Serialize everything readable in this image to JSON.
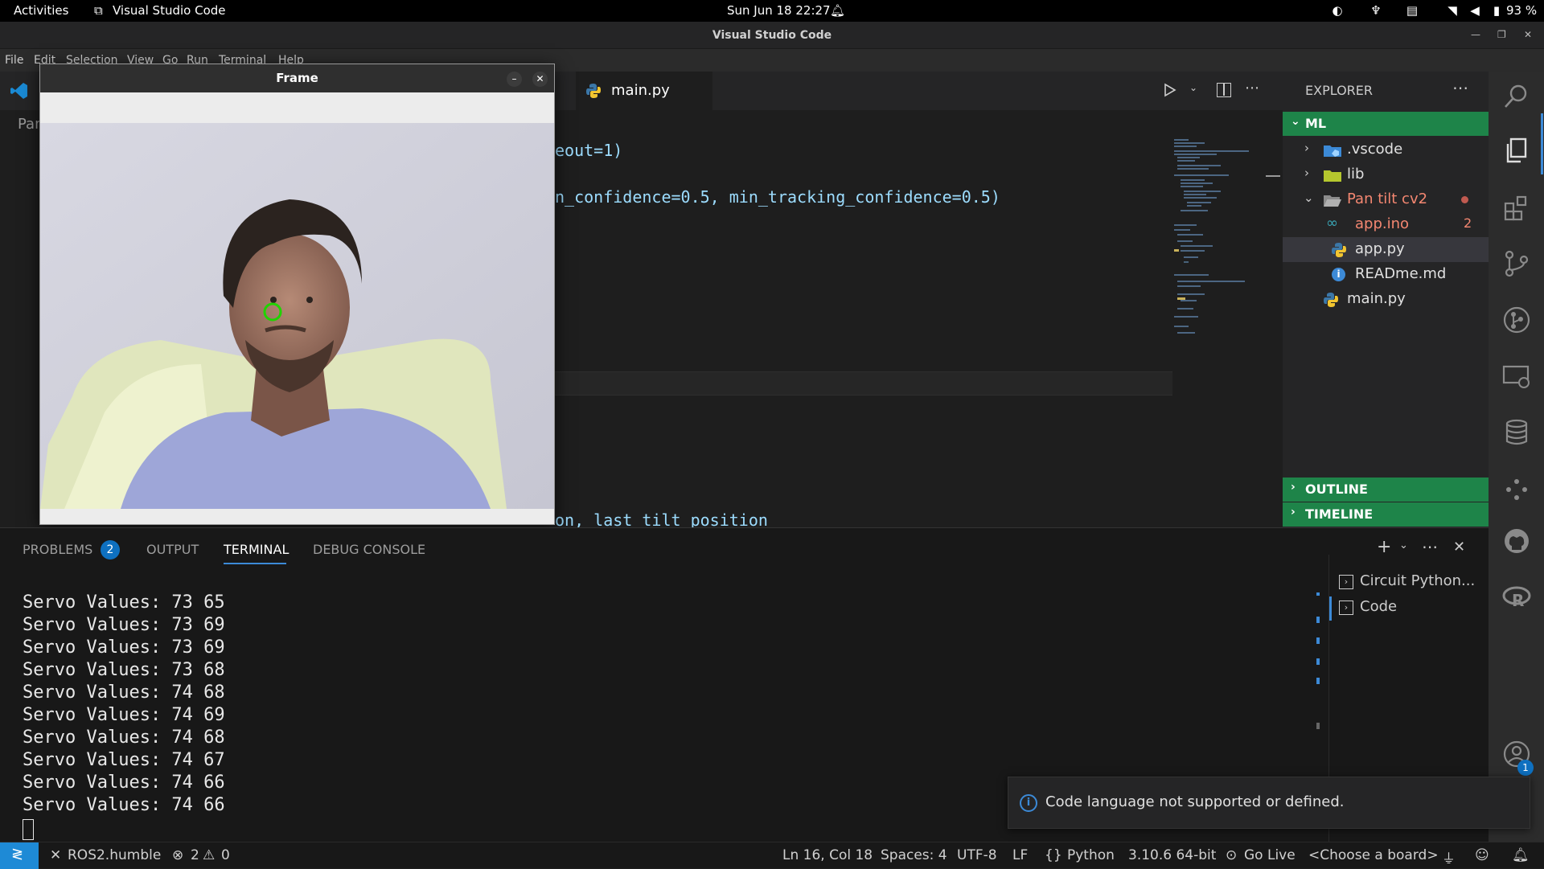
{
  "topbar": {
    "activities": "Activities",
    "app_name": "Visual Studio Code",
    "clock": "Sun Jun 18  22:27",
    "battery": "93 %"
  },
  "window": {
    "title": "Visual Studio Code"
  },
  "menubar": {
    "items": [
      "File",
      "Edit",
      "Selection",
      "View",
      "Go",
      "Run",
      "Terminal",
      "Help"
    ]
  },
  "editor": {
    "tab_label": "main.py",
    "partial_left_label": "Pan",
    "code_lines": [
      "eout=1)",
      "n_confidence=0.5, min_tracking_confidence=0.5)",
      "on, last tilt position"
    ]
  },
  "frame_window": {
    "title": "Frame"
  },
  "explorer": {
    "header": "EXPLORER",
    "root": "ML",
    "items": [
      {
        "label": ".vscode",
        "kind": "folder",
        "icon": "vscode-folder-icon"
      },
      {
        "label": "lib",
        "kind": "folder",
        "icon": "folder-icon"
      },
      {
        "label": "Pan tilt cv2",
        "kind": "folder-open",
        "icon": "folder-open-icon"
      },
      {
        "label": "app.ino",
        "kind": "file",
        "icon": "arduino-icon",
        "badge": "2"
      },
      {
        "label": "app.py",
        "kind": "file",
        "icon": "python-icon"
      },
      {
        "label": "READme.md",
        "kind": "file",
        "icon": "info-icon"
      },
      {
        "label": "main.py",
        "kind": "file",
        "icon": "python-icon"
      }
    ],
    "outline": "OUTLINE",
    "timeline": "TIMELINE"
  },
  "panel": {
    "tabs": {
      "problems": "PROBLEMS",
      "problems_count": "2",
      "output": "OUTPUT",
      "terminal": "TERMINAL",
      "debug": "DEBUG CONSOLE"
    },
    "terminal_lines": [
      "Servo Values: 73 65",
      "Servo Values: 73 69",
      "Servo Values: 73 69",
      "Servo Values: 73 68",
      "Servo Values: 74 68",
      "Servo Values: 74 69",
      "Servo Values: 74 68",
      "Servo Values: 74 67",
      "Servo Values: 74 66",
      "Servo Values: 74 66"
    ],
    "terminal_list": [
      "Circuit Python...",
      "Code"
    ]
  },
  "notification": {
    "message": "Code language not supported or defined."
  },
  "statusbar": {
    "ros": "ROS2.humble",
    "errors": "2",
    "warnings": "0",
    "position": "Ln 16, Col 18",
    "spaces": "Spaces: 4",
    "encoding": "UTF-8",
    "eol": "LF",
    "language": "Python",
    "interpreter": "3.10.6 64-bit",
    "golive": "Go Live",
    "board": "<Choose a board>"
  },
  "accounts_badge": "1",
  "colors": {
    "accent_green": "#1e8449",
    "status_blue": "#1e8ad6",
    "badge_blue": "#0e70c0"
  }
}
